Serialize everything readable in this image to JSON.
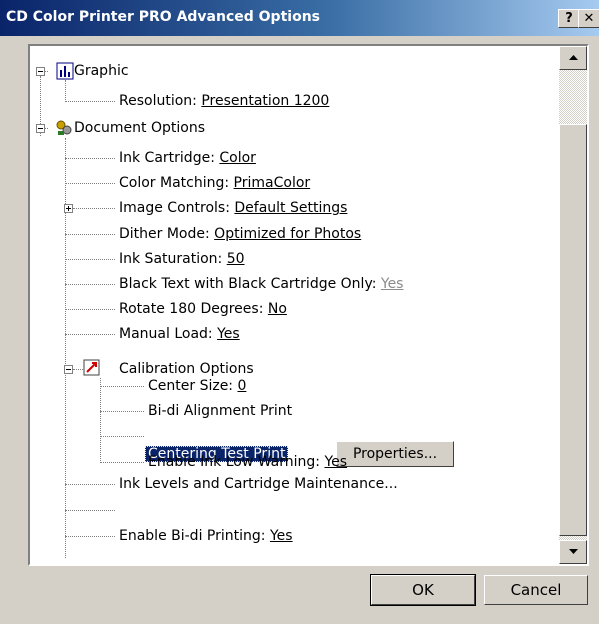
{
  "window": {
    "title": "CD Color Printer PRO Advanced Options",
    "help_label": "?",
    "close_label": "✕"
  },
  "tree": {
    "graphic": {
      "label": "Graphic"
    },
    "resolution": {
      "label": "Resolution: ",
      "value": "Presentation 1200"
    },
    "document_options": {
      "label": "Document Options"
    },
    "ink_cartridge": {
      "label": "Ink Cartridge: ",
      "value": "Color"
    },
    "color_matching": {
      "label": "Color Matching: ",
      "value": "PrimaColor"
    },
    "image_controls": {
      "label": "Image Controls: ",
      "value": "Default Settings"
    },
    "dither_mode": {
      "label": "Dither Mode: ",
      "value": "Optimized for Photos"
    },
    "ink_saturation": {
      "label": "Ink Saturation: ",
      "value": "50"
    },
    "black_text": {
      "label": "Black Text with Black Cartridge Only: ",
      "value": "Yes"
    },
    "rotate_180": {
      "label": "Rotate 180 Degrees: ",
      "value": "No"
    },
    "manual_load": {
      "label": "Manual Load: ",
      "value": "Yes"
    },
    "calibration_options": {
      "label": "Calibration Options"
    },
    "center_size": {
      "label": "Center Size: ",
      "value": "0"
    },
    "bidi_alignment": {
      "label": "Bi-di Alignment Print"
    },
    "centering_test": {
      "label": "Centering Test Print"
    },
    "properties_button": "Properties...",
    "enable_ink_low": {
      "label": "Enable Ink Low Warning: ",
      "value": "Yes"
    },
    "ink_levels": {
      "label": "Ink Levels and Cartridge Maintenance..."
    },
    "enable_bidi": {
      "label": "Enable Bi-di Printing: ",
      "value": "Yes"
    }
  },
  "buttons": {
    "ok": "OK",
    "cancel": "Cancel"
  },
  "colors": {
    "title_start": "#0a246a",
    "selection": "#0a246a",
    "face": "#d4d0c8",
    "disabled_value": "#8a8a8a"
  }
}
